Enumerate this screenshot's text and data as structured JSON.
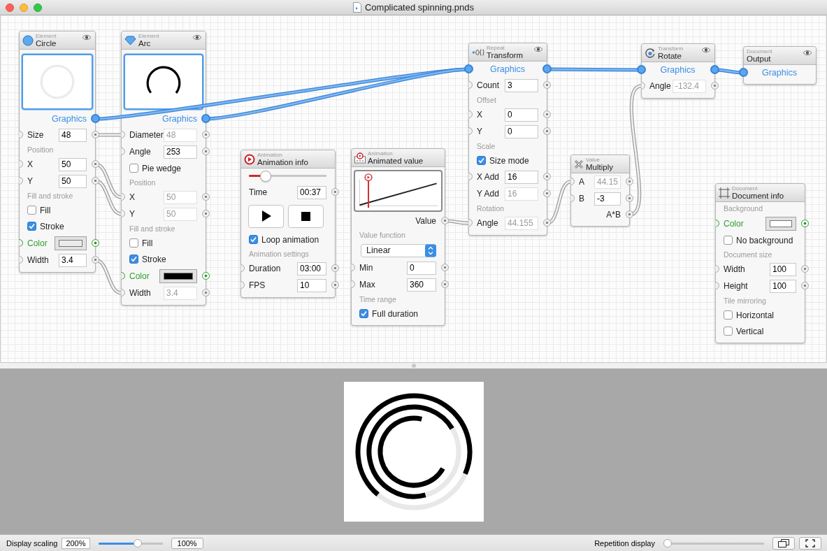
{
  "window": {
    "title": "Complicated spinning.pnds"
  },
  "nodes": [
    {
      "category": "Element",
      "title": "Circle",
      "kind": "circle",
      "eye": true,
      "rows": [
        {
          "kind": "circle-preview"
        },
        {
          "kind": "graphics",
          "label": "Graphics",
          "in": false,
          "out": true
        },
        {
          "kind": "field",
          "label": "Size",
          "value": "48",
          "disabled": false,
          "in": true,
          "out": true
        },
        {
          "kind": "section",
          "label": "Position"
        },
        {
          "kind": "field",
          "label": "X",
          "value": "50",
          "disabled": false,
          "in": true,
          "out": true
        },
        {
          "kind": "field",
          "label": "Y",
          "value": "50",
          "disabled": false,
          "in": true,
          "out": true
        },
        {
          "kind": "section",
          "label": "Fill and stroke"
        },
        {
          "kind": "checkbox",
          "label": "Fill",
          "checked": false
        },
        {
          "kind": "checkbox",
          "label": "Stroke",
          "checked": true
        },
        {
          "kind": "color",
          "label": "Color",
          "color": "#ebebeb",
          "in": true,
          "out": true
        },
        {
          "kind": "field",
          "label": "Width",
          "value": "3.4",
          "disabled": false,
          "in": true,
          "out": true
        }
      ]
    },
    {
      "category": "Element",
      "title": "Arc",
      "kind": "arc",
      "eye": true,
      "rows": [
        {
          "kind": "arc-preview"
        },
        {
          "kind": "graphics",
          "label": "Graphics",
          "in": false,
          "out": true
        },
        {
          "kind": "field",
          "label": "Diameter",
          "value": "48",
          "disabled": true,
          "in": true,
          "out": true
        },
        {
          "kind": "field",
          "label": "Angle",
          "value": "253",
          "disabled": false,
          "in": true,
          "out": true
        },
        {
          "kind": "checkbox",
          "label": "Pie wedge",
          "checked": false
        },
        {
          "kind": "section",
          "label": "Position"
        },
        {
          "kind": "field",
          "label": "X",
          "value": "50",
          "disabled": true,
          "in": true,
          "out": true
        },
        {
          "kind": "field",
          "label": "Y",
          "value": "50",
          "disabled": true,
          "in": true,
          "out": true
        },
        {
          "kind": "section",
          "label": "Fill and stroke"
        },
        {
          "kind": "checkbox",
          "label": "Fill",
          "checked": false
        },
        {
          "kind": "checkbox",
          "label": "Stroke",
          "checked": true
        },
        {
          "kind": "color",
          "label": "Color",
          "color": "#000000",
          "in": true,
          "out": true
        },
        {
          "kind": "field",
          "label": "Width",
          "value": "3.4",
          "disabled": true,
          "in": true,
          "out": true
        }
      ]
    },
    {
      "category": "Animation",
      "title": "Animation info",
      "kind": "animation",
      "eye": false,
      "rows": [
        {
          "kind": "slider",
          "level": 0.17
        },
        {
          "kind": "field",
          "label": "Time",
          "value": "00:37",
          "disabled": false,
          "in": false,
          "out": true
        },
        {
          "kind": "transport"
        },
        {
          "kind": "checkbox",
          "label": "Loop animation",
          "checked": true
        },
        {
          "kind": "section",
          "label": "Animation settings"
        },
        {
          "kind": "field",
          "label": "Duration",
          "value": "03:00",
          "disabled": false,
          "in": true,
          "out": true
        },
        {
          "kind": "field",
          "label": "FPS",
          "value": "10",
          "disabled": false,
          "in": true,
          "out": true
        }
      ]
    },
    {
      "category": "Animation",
      "title": "Animated value",
      "kind": "animated-value",
      "eye": false,
      "rows": [
        {
          "kind": "curve-preview"
        },
        {
          "kind": "output",
          "label": "Value",
          "out": true
        },
        {
          "kind": "section",
          "label": "Value function"
        },
        {
          "kind": "select",
          "value": "Linear"
        },
        {
          "kind": "field",
          "label": "Min",
          "value": "0",
          "disabled": false,
          "in": true,
          "out": true
        },
        {
          "kind": "field",
          "label": "Max",
          "value": "360",
          "disabled": false,
          "in": true,
          "out": true
        },
        {
          "kind": "section",
          "label": "Time range"
        },
        {
          "kind": "checkbox",
          "label": "Full duration",
          "checked": true
        }
      ]
    },
    {
      "category": "Repeat",
      "title": "Transform",
      "kind": "repeat",
      "eye": true,
      "rows": [
        {
          "kind": "graphics",
          "label": "Graphics",
          "in": true,
          "out": true
        },
        {
          "kind": "field",
          "label": "Count",
          "value": "3",
          "disabled": false,
          "in": true,
          "out": true
        },
        {
          "kind": "section",
          "label": "Offset"
        },
        {
          "kind": "field",
          "label": "X",
          "value": "0",
          "disabled": false,
          "in": true,
          "out": true
        },
        {
          "kind": "field",
          "label": "Y",
          "value": "0",
          "disabled": false,
          "in": true,
          "out": true
        },
        {
          "kind": "section",
          "label": "Scale"
        },
        {
          "kind": "checkbox",
          "label": "Size mode",
          "checked": true
        },
        {
          "kind": "field",
          "label": "X Add",
          "value": "16",
          "disabled": false,
          "in": true,
          "out": true
        },
        {
          "kind": "field",
          "label": "Y Add",
          "value": "16",
          "disabled": true,
          "in": false,
          "out": true
        },
        {
          "kind": "section",
          "label": "Rotation"
        },
        {
          "kind": "field",
          "label": "Angle",
          "value": "44.155",
          "disabled": true,
          "in": true,
          "out": true
        }
      ]
    },
    {
      "category": "Value",
      "title": "Multiply",
      "kind": "multiply",
      "eye": false,
      "rows": [
        {
          "kind": "field",
          "label": "A",
          "value": "44.15",
          "disabled": true,
          "in": true,
          "out": true
        },
        {
          "kind": "field",
          "label": "B",
          "value": "-3",
          "disabled": false,
          "in": true,
          "out": true
        },
        {
          "kind": "output",
          "label": "A*B",
          "out": true
        }
      ]
    },
    {
      "category": "Transform",
      "title": "Rotate",
      "kind": "rotate",
      "eye": true,
      "rows": [
        {
          "kind": "graphics",
          "label": "Graphics",
          "in": true,
          "out": true
        },
        {
          "kind": "field",
          "label": "Angle",
          "value": "-132.4",
          "disabled": true,
          "in": true,
          "out": true
        }
      ]
    },
    {
      "category": "Document",
      "title": "Output",
      "kind": "plain",
      "eye": true,
      "rows": [
        {
          "kind": "graphics",
          "label": "Graphics",
          "in": true,
          "out": false
        }
      ]
    },
    {
      "category": "Document",
      "title": "Document info",
      "kind": "document",
      "eye": false,
      "rows": [
        {
          "kind": "section",
          "label": "Background"
        },
        {
          "kind": "color",
          "label": "Color",
          "color": "#ffffff",
          "in": true,
          "out": true
        },
        {
          "kind": "checkbox",
          "label": "No background",
          "checked": false
        },
        {
          "kind": "section",
          "label": "Document size"
        },
        {
          "kind": "field",
          "label": "Width",
          "value": "100",
          "disabled": false,
          "in": true,
          "out": true
        },
        {
          "kind": "field",
          "label": "Height",
          "value": "100",
          "disabled": false,
          "in": true,
          "out": true
        },
        {
          "kind": "section",
          "label": "Tile mirroring"
        },
        {
          "kind": "checkbox",
          "label": "Horizontal",
          "checked": false
        },
        {
          "kind": "checkbox",
          "label": "Vertical",
          "checked": false
        }
      ]
    }
  ],
  "status_bar": {
    "scaling": {
      "label": "Display scaling",
      "value": "200%",
      "level": 0.63,
      "reset": "100%"
    },
    "repetition": {
      "label": "Repetition display",
      "level": 0
    }
  }
}
